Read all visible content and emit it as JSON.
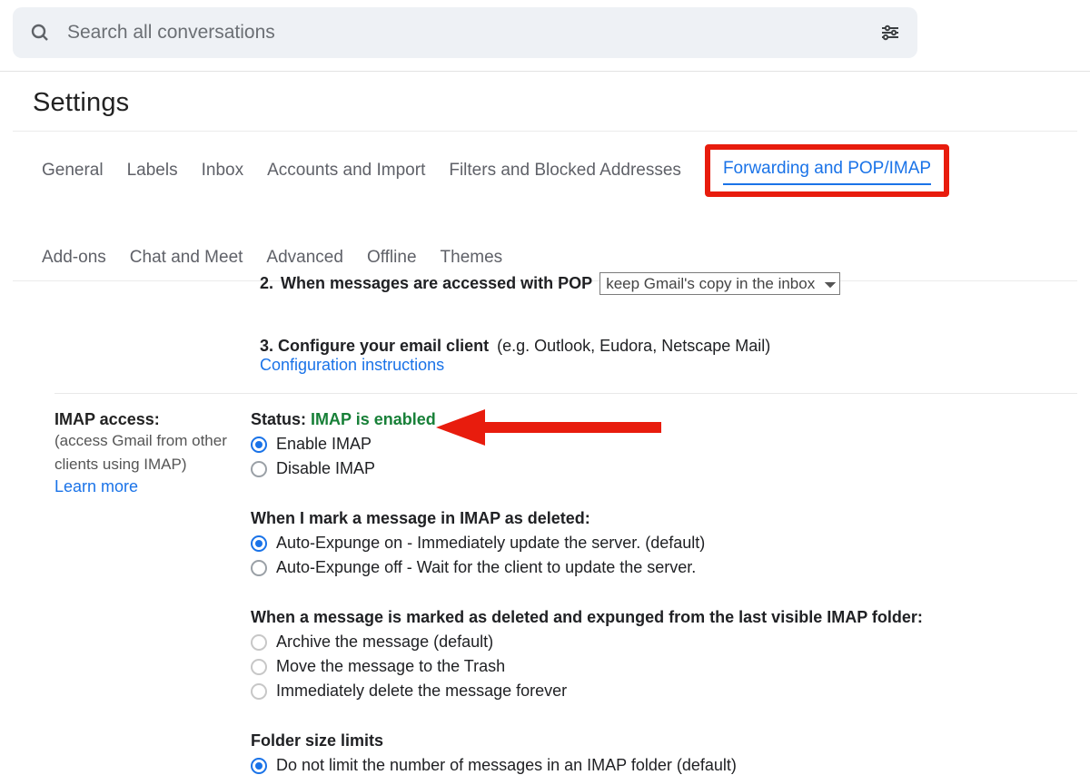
{
  "search": {
    "placeholder": "Search all conversations"
  },
  "page_title": "Settings",
  "tabs": {
    "general": "General",
    "labels": "Labels",
    "inbox": "Inbox",
    "accounts": "Accounts and Import",
    "filters": "Filters and Blocked Addresses",
    "forwarding": "Forwarding and POP/IMAP",
    "addons": "Add-ons",
    "chat": "Chat and Meet",
    "advanced": "Advanced",
    "offline": "Offline",
    "themes": "Themes"
  },
  "pop": {
    "step2": {
      "num": "2.",
      "label": "When messages are accessed with POP",
      "select_value": "keep Gmail's copy in the inbox"
    },
    "step3": {
      "num": "3.",
      "label": "Configure your email client",
      "hint": "(e.g. Outlook, Eudora, Netscape Mail)",
      "link": "Configuration instructions"
    }
  },
  "imap": {
    "left_heading": "IMAP access:",
    "left_sub": "(access Gmail from other clients using IMAP)",
    "learn_more": "Learn more",
    "status_label": "Status:",
    "status_value": "IMAP is enabled",
    "enable_label": "Enable IMAP",
    "disable_label": "Disable IMAP",
    "delete_heading": "When I mark a message in IMAP as deleted:",
    "expunge_on": "Auto-Expunge on - Immediately update the server. (default)",
    "expunge_off": "Auto-Expunge off - Wait for the client to update the server.",
    "after_heading": "When a message is marked as deleted and expunged from the last visible IMAP folder:",
    "after_archive": "Archive the message (default)",
    "after_trash": "Move the message to the Trash",
    "after_delete": "Immediately delete the message forever",
    "folder_heading": "Folder size limits",
    "folder_opt1": "Do not limit the number of messages in an IMAP folder (default)"
  }
}
